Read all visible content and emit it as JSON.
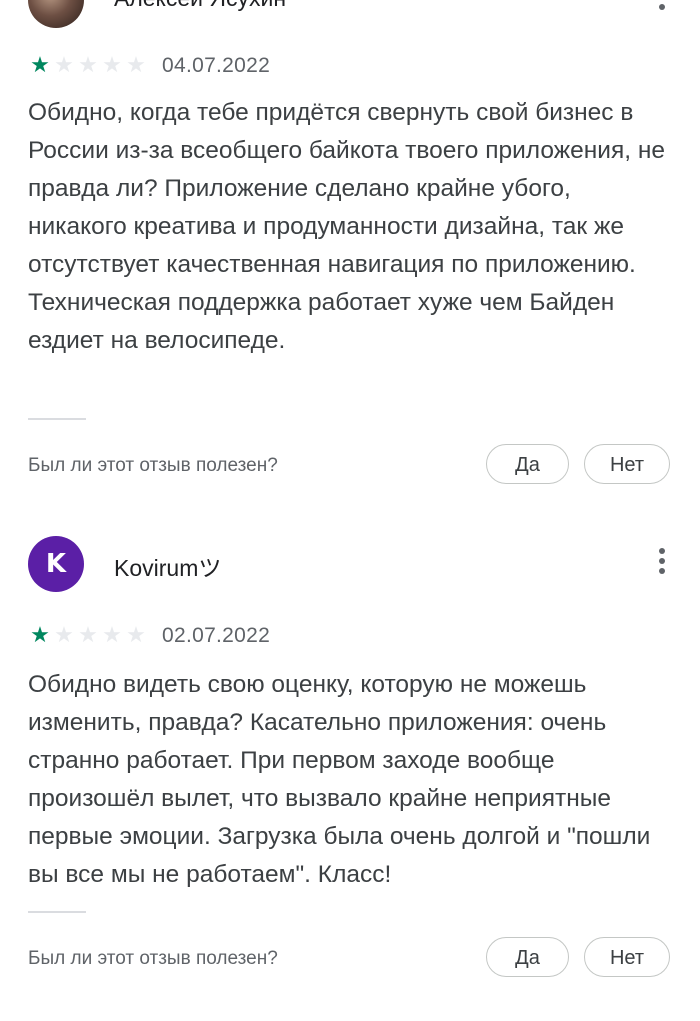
{
  "reviews": [
    {
      "author": "Алексей Ясухин",
      "avatar_type": "photo",
      "rating": 1,
      "max_rating": 5,
      "stars": [
        "★",
        "★",
        "★",
        "★",
        "★"
      ],
      "date": "04.07.2022",
      "text": "Обидно, когда тебе придётся свернуть свой бизнес в России из-за всеобщего байкота твоего приложения, не правда ли? Приложение сделано крайне убого, никакого креатива и продуманности дизайна, так же отсутствует качественная навигация по приложению. Техническая поддержка работает хуже чем Байден ездиет на велосипеде.",
      "helpful_question": "Был ли этот отзыв полезен?",
      "yes_label": "Да",
      "no_label": "Нет"
    },
    {
      "author": "Kovirumツ",
      "avatar_letter": "K",
      "avatar_color": "#5b1fa6",
      "rating": 1,
      "max_rating": 5,
      "stars": [
        "★",
        "★",
        "★",
        "★",
        "★"
      ],
      "date": "02.07.2022",
      "text": "Обидно видеть свою оценку, которую не можешь изменить, правда? Касательно приложения: очень странно работает. При первом заходе вообще произошёл вылет, что вызвало крайне неприятные первые эмоции. Загрузка была очень долгой и \"пошли вы все мы не работаем\". Класс!",
      "helpful_question": "Был ли этот отзыв полезен?",
      "yes_label": "Да",
      "no_label": "Нет"
    }
  ],
  "colors": {
    "star_filled": "#01875f",
    "star_empty": "#e8eaed",
    "text": "#3c4043",
    "secondary_text": "#5f6368"
  }
}
